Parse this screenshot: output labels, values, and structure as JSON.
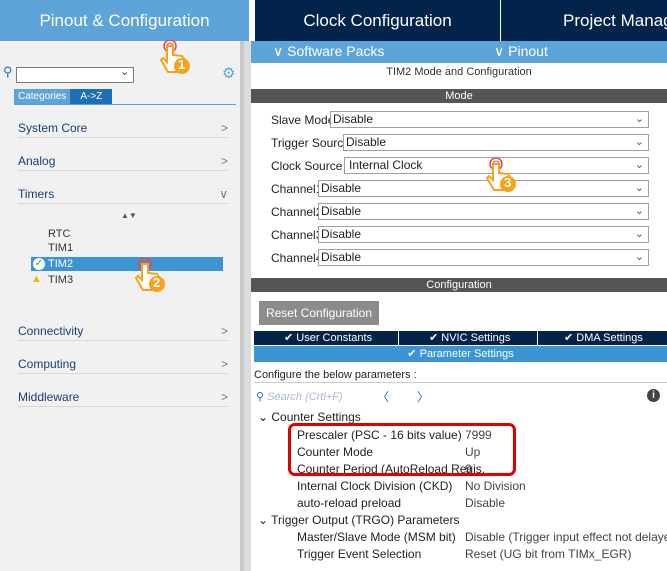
{
  "top_tabs": [
    "Pinout & Configuration",
    "Clock Configuration",
    "Project Manag"
  ],
  "subbar": {
    "software_packs": "∨ Software Packs",
    "pinout": "∨ Pinout"
  },
  "left": {
    "cat_tabs": [
      "Categories",
      "A->Z"
    ],
    "categories": [
      {
        "label": "System Core",
        "chev": ">"
      },
      {
        "label": "Analog",
        "chev": ">"
      },
      {
        "label": "Timers",
        "chev": "∨"
      },
      {
        "label": "Connectivity",
        "chev": ">"
      },
      {
        "label": "Computing",
        "chev": ">"
      },
      {
        "label": "Middleware",
        "chev": ">"
      }
    ],
    "timers": [
      "RTC",
      "TIM1",
      "TIM2",
      "TIM3"
    ]
  },
  "right": {
    "title": "TIM2 Mode and Configuration",
    "mode_header": "Mode",
    "config_header": "Configuration",
    "mode_fields": [
      {
        "label": "Slave Mode",
        "value": "Disable"
      },
      {
        "label": "Trigger Source",
        "value": "Disable"
      },
      {
        "label": "Clock Source",
        "value": "Internal Clock"
      },
      {
        "label": "Channel1",
        "value": "Disable"
      },
      {
        "label": "Channel2",
        "value": "Disable"
      },
      {
        "label": "Channel3",
        "value": "Disable"
      },
      {
        "label": "Channel4",
        "value": "Disable"
      }
    ],
    "reset_button": "Reset Configuration",
    "param_tabs": [
      "User Constants",
      "NVIC Settings",
      "DMA Settings",
      "Parameter Settings"
    ],
    "configure_text": "Configure the below parameters :",
    "search_placeholder": "Search (Crtl+F)",
    "tree": {
      "counter_settings": "Counter Settings",
      "prescaler": "Prescaler (PSC - 16 bits value)",
      "prescaler_val": "7999",
      "counter_mode": "Counter Mode",
      "counter_mode_val": "Up",
      "counter_period": "Counter Period (AutoReload Regis.",
      "counter_period_val": "9",
      "ckd": "Internal Clock Division (CKD)",
      "ckd_val": "No Division",
      "arp": "auto-reload preload",
      "arp_val": "Disable",
      "trgo": "Trigger Output (TRGO) Parameters",
      "msm": "Master/Slave Mode (MSM bit)",
      "msm_val": "Disable (Trigger input effect not delayed)",
      "tes": "Trigger Event Selection",
      "tes_val": "Reset (UG bit from TIMx_EGR)"
    }
  },
  "hand_numbers": [
    "1",
    "2",
    "3"
  ],
  "colors": {
    "tab_light": "#5da4d8",
    "tab_dark": "#03234b",
    "highlight": "#e00000",
    "hand": "#f7a21b"
  }
}
